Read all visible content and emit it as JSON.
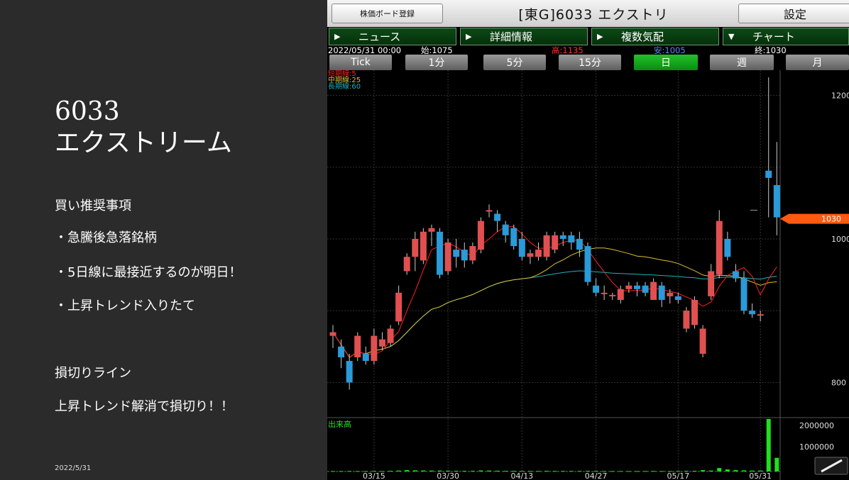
{
  "slide": {
    "title_line1": "6033",
    "title_line2": "エクストリーム",
    "buy_heading": "買い推奨事項",
    "buy_points": [
      "・急騰後急落銘柄",
      "・5日線に最接近するのが明日！",
      "・上昇トレンド入りたて"
    ],
    "stop_heading": "損切りライン",
    "stop_text": "上昇トレンド解消で損切り！！",
    "date": "2022/5/31"
  },
  "app": {
    "register_button": "株価ボード登録",
    "title": "[東G]6033 エクストリ",
    "settings_button": "設定",
    "tabs": [
      {
        "arrow": "▶",
        "label": "ニュース"
      },
      {
        "arrow": "▶",
        "label": "詳細情報"
      },
      {
        "arrow": "▶",
        "label": "複数気配"
      },
      {
        "arrow": "▼",
        "label": "チャート"
      }
    ],
    "info": {
      "datetime": "2022/05/31 00:00",
      "open": "始:1075",
      "high": "高:1135",
      "low": "安:1005",
      "close": "終:1030"
    },
    "periods": [
      "Tick",
      "1分",
      "5分",
      "15分",
      "日",
      "週",
      "月"
    ],
    "active_period": "日",
    "colors": {
      "up": "#e05050",
      "down": "#2a9ad8",
      "ma_short": "#ff2020",
      "ma_mid": "#d8c030",
      "ma_long": "#20b0c0",
      "volume": "#20e020",
      "active_tab": "#14a81c",
      "price_tag": "#ff5a10"
    }
  },
  "chart_data": {
    "type": "candlestick",
    "legend": [
      "短期線:5",
      "中期線:25",
      "長期線:60"
    ],
    "volume_label": "出来高",
    "y_ticks": [
      {
        "value": 1200,
        "label": "1200"
      },
      {
        "value": 1000,
        "label": "1000"
      },
      {
        "value": 800,
        "label": "800"
      }
    ],
    "volume_ticks": [
      {
        "value": 2000000,
        "label": "2000000"
      },
      {
        "value": 1000000,
        "label": "1000000"
      }
    ],
    "x_ticks": [
      {
        "index": 5,
        "label": "03/15"
      },
      {
        "index": 14,
        "label": "03/30"
      },
      {
        "index": 23,
        "label": "04/13"
      },
      {
        "index": 32,
        "label": "04/27"
      },
      {
        "index": 42,
        "label": "05/17"
      },
      {
        "index": 52,
        "label": "05/31"
      }
    ],
    "ylim": [
      755,
      1235
    ],
    "current_price": "1030",
    "candles": [
      {
        "o": 865,
        "h": 880,
        "l": 848,
        "c": 870
      },
      {
        "o": 850,
        "h": 860,
        "l": 820,
        "c": 835
      },
      {
        "o": 830,
        "h": 840,
        "l": 790,
        "c": 800
      },
      {
        "o": 835,
        "h": 870,
        "l": 830,
        "c": 865
      },
      {
        "o": 840,
        "h": 850,
        "l": 825,
        "c": 830
      },
      {
        "o": 830,
        "h": 875,
        "l": 825,
        "c": 865
      },
      {
        "o": 850,
        "h": 870,
        "l": 845,
        "c": 860
      },
      {
        "o": 855,
        "h": 880,
        "l": 850,
        "c": 875
      },
      {
        "o": 885,
        "h": 935,
        "l": 880,
        "c": 925
      },
      {
        "o": 955,
        "h": 980,
        "l": 950,
        "c": 975
      },
      {
        "o": 975,
        "h": 1010,
        "l": 955,
        "c": 1000
      },
      {
        "o": 970,
        "h": 1015,
        "l": 965,
        "c": 1010
      },
      {
        "o": 1010,
        "h": 1020,
        "l": 990,
        "c": 1015
      },
      {
        "o": 1010,
        "h": 1015,
        "l": 945,
        "c": 950
      },
      {
        "o": 955,
        "h": 1000,
        "l": 950,
        "c": 995
      },
      {
        "o": 985,
        "h": 1000,
        "l": 960,
        "c": 975
      },
      {
        "o": 985,
        "h": 995,
        "l": 960,
        "c": 970
      },
      {
        "o": 970,
        "h": 995,
        "l": 965,
        "c": 990
      },
      {
        "o": 985,
        "h": 1030,
        "l": 980,
        "c": 1025
      },
      {
        "o": 1040,
        "h": 1048,
        "l": 1030,
        "c": 1040
      },
      {
        "o": 1035,
        "h": 1040,
        "l": 1010,
        "c": 1025
      },
      {
        "o": 1020,
        "h": 1025,
        "l": 995,
        "c": 1005
      },
      {
        "o": 1015,
        "h": 1020,
        "l": 985,
        "c": 990
      },
      {
        "o": 1000,
        "h": 1010,
        "l": 970,
        "c": 975
      },
      {
        "o": 975,
        "h": 985,
        "l": 965,
        "c": 980
      },
      {
        "o": 975,
        "h": 995,
        "l": 970,
        "c": 985
      },
      {
        "o": 975,
        "h": 1010,
        "l": 970,
        "c": 1005
      },
      {
        "o": 985,
        "h": 1010,
        "l": 980,
        "c": 1005
      },
      {
        "o": 1005,
        "h": 1010,
        "l": 990,
        "c": 1000
      },
      {
        "o": 1005,
        "h": 1010,
        "l": 985,
        "c": 995
      },
      {
        "o": 1000,
        "h": 1010,
        "l": 975,
        "c": 985
      },
      {
        "o": 990,
        "h": 995,
        "l": 935,
        "c": 940
      },
      {
        "o": 935,
        "h": 945,
        "l": 920,
        "c": 925
      },
      {
        "o": 925,
        "h": 935,
        "l": 915,
        "c": 925
      },
      {
        "o": 920,
        "h": 925,
        "l": 915,
        "c": 922
      },
      {
        "o": 915,
        "h": 935,
        "l": 910,
        "c": 930
      },
      {
        "o": 930,
        "h": 940,
        "l": 925,
        "c": 935
      },
      {
        "o": 935,
        "h": 940,
        "l": 920,
        "c": 930
      },
      {
        "o": 935,
        "h": 940,
        "l": 920,
        "c": 925
      },
      {
        "o": 915,
        "h": 945,
        "l": 915,
        "c": 940
      },
      {
        "o": 935,
        "h": 940,
        "l": 905,
        "c": 915
      },
      {
        "o": 920,
        "h": 930,
        "l": 910,
        "c": 925
      },
      {
        "o": 920,
        "h": 925,
        "l": 910,
        "c": 915
      },
      {
        "o": 875,
        "h": 905,
        "l": 870,
        "c": 900
      },
      {
        "o": 880,
        "h": 920,
        "l": 875,
        "c": 915
      },
      {
        "o": 840,
        "h": 880,
        "l": 835,
        "c": 875
      },
      {
        "o": 920,
        "h": 965,
        "l": 915,
        "c": 955
      },
      {
        "o": 950,
        "h": 1040,
        "l": 945,
        "c": 1025
      },
      {
        "o": 1000,
        "h": 1010,
        "l": 970,
        "c": 975
      },
      {
        "o": 955,
        "h": 965,
        "l": 940,
        "c": 945
      },
      {
        "o": 945,
        "h": 955,
        "l": 895,
        "c": 900
      },
      {
        "o": 900,
        "h": 910,
        "l": 890,
        "c": 895
      },
      {
        "o": 895,
        "h": 900,
        "l": 885,
        "c": 895
      },
      {
        "o": 1095,
        "h": 1225,
        "l": 1030,
        "c": 1085
      },
      {
        "o": 1075,
        "h": 1135,
        "l": 1005,
        "c": 1030
      }
    ],
    "volume": [
      20000,
      20000,
      25000,
      20000,
      20000,
      25000,
      20000,
      30000,
      40000,
      60000,
      50000,
      45000,
      40000,
      40000,
      35000,
      30000,
      30000,
      30000,
      45000,
      40000,
      35000,
      30000,
      30000,
      25000,
      25000,
      25000,
      30000,
      25000,
      25000,
      25000,
      25000,
      30000,
      25000,
      20000,
      20000,
      20000,
      20000,
      20000,
      20000,
      25000,
      20000,
      20000,
      20000,
      30000,
      30000,
      60000,
      40000,
      150000,
      90000,
      60000,
      50000,
      40000,
      40000,
      2300000,
      600000
    ]
  }
}
